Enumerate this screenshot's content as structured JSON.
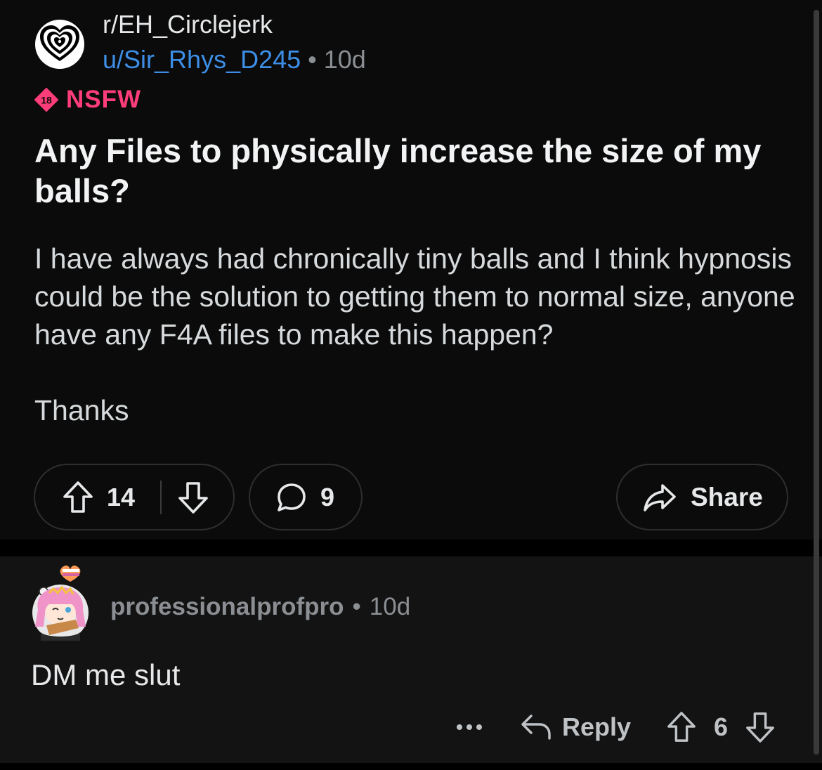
{
  "post": {
    "subreddit": "r/EH_Circlejerk",
    "author": "u/Sir_Rhys_D245",
    "separator": "•",
    "age": "10d",
    "nsfw_badge_number": "18",
    "nsfw_label": "NSFW",
    "title": "Any Files to physically increase the size of my balls?",
    "body_paragraphs": [
      "I have always had chronically tiny balls and I think hypnosis could be the solution to getting them to normal size, anyone have any F4A files to make this happen?",
      "Thanks"
    ],
    "score": "14",
    "comments_count": "9",
    "share_label": "Share"
  },
  "comment": {
    "author": "professionalprofpro",
    "separator": "•",
    "age": "10d",
    "body": "DM me slut",
    "reply_label": "Reply",
    "score": "6"
  },
  "colors": {
    "background": "#0b0b0b",
    "username": "#3d8ee6",
    "nsfw": "#ff3d7b",
    "muted": "#8b8f93",
    "comment_background": "#131313"
  },
  "icons": {
    "subreddit_avatar": "hypnotic-heart-icon",
    "upvote": "arrow-up-outline-icon",
    "downvote": "arrow-down-outline-icon",
    "comments": "speech-bubble-icon",
    "share": "share-arrow-icon",
    "reply": "reply-arrow-icon",
    "more": "ellipsis-icon",
    "user_avatar": "anime-girl-avatar",
    "flair": "heart-pride-flag-icon"
  }
}
